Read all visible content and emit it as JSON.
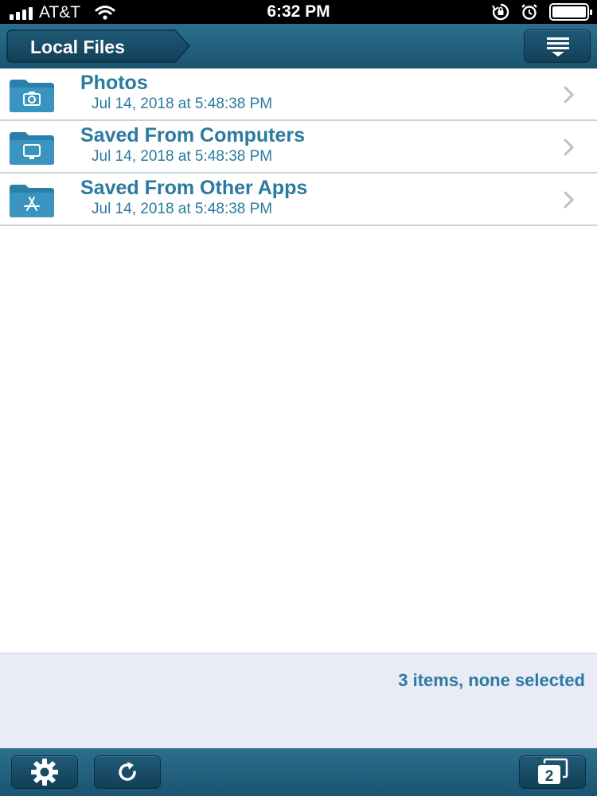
{
  "status_bar": {
    "carrier": "AT&T",
    "time": "6:32 PM",
    "icons": [
      "signal-icon",
      "wifi-icon",
      "rotation-lock-icon",
      "alarm-icon",
      "battery-icon"
    ]
  },
  "nav": {
    "back_label": "Local Files",
    "menu_icon": "list-menu-icon"
  },
  "files": [
    {
      "name": "Photos",
      "date": "Jul 14, 2018 at 5:48:38 PM",
      "icon": "folder-camera-icon"
    },
    {
      "name": "Saved From Computers",
      "date": "Jul 14, 2018 at 5:48:38 PM",
      "icon": "folder-monitor-icon"
    },
    {
      "name": "Saved From Other Apps",
      "date": "Jul 14, 2018 at 5:48:38 PM",
      "icon": "folder-appstore-icon"
    }
  ],
  "summary": "3 items, none selected",
  "toolbar": {
    "icons": [
      "gear-icon",
      "refresh-icon",
      "windows-icon"
    ],
    "window_count": "2"
  },
  "colors": {
    "bar": "#1f6483",
    "accent_text": "#2b7aa0",
    "summary_bg": "#e9ebf6",
    "folder": "#2b80ab"
  }
}
